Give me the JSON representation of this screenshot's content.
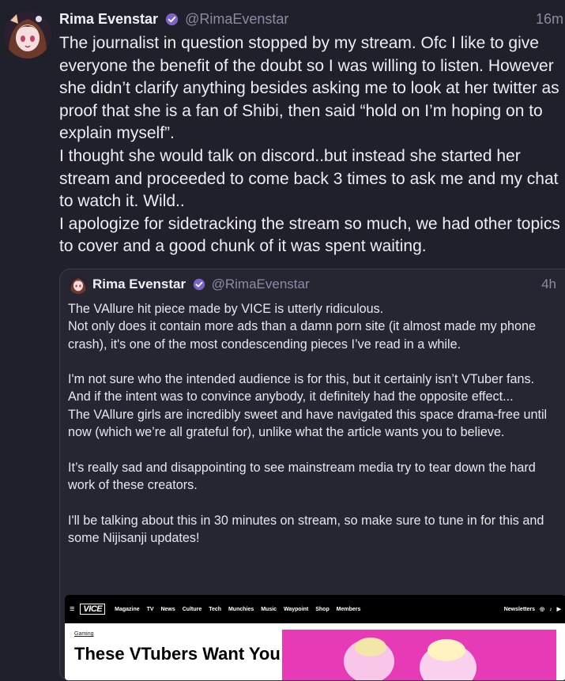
{
  "tweet": {
    "display_name": "Rima Evenstar",
    "handle": "@RimaEvenstar",
    "time": "16m",
    "paragraphs": [
      "The journalist in question stopped by my stream. Ofc I like to give everyone the benefit of the doubt so I was willing to listen. However she didn’t clarify anything besides asking me to look at her twitter as proof that she is a fan of Shibi, then said “hold on I’m hoping on to explain myself”.",
      "I thought she would talk on discord..but instead she started her stream and proceeded to come back 3 times to ask me and my chat to watch it. Wild..",
      "I apologize for sidetracking the stream so much, we had other topics to cover and a good chunk of it was spent waiting."
    ]
  },
  "quoted": {
    "display_name": "Rima Evenstar",
    "handle": "@RimaEvenstar",
    "time": "4h",
    "p1": "The VAllure hit piece made by VICE is utterly ridiculous.",
    "p2": "Not only does it contain more ads than a damn porn site (it almost made my phone crash), it's one of the most condescending pieces I’ve read in a while.",
    "p3": "I'm not sure who the intended audience is for this, but it certainly isn’t VTuber fans. And if the intent was to convince anybody, it definitely had the opposite effect...",
    "p4": "The VAllure girls are incredibly sweet and have navigated this space drama-free until now (which we’re all grateful for), unlike what the article wants you to believe.",
    "p5": "It’s really sad and disappointing to see mainstream media try to tear down the hard work of these creators.",
    "p6": "I'll be talking about this in 30 minutes on stream, so make sure to tune in for this and some Nijisanji updates!"
  },
  "embed": {
    "logo": "VICE",
    "nav": [
      "Magazine",
      "TV",
      "News",
      "Culture",
      "Tech",
      "Munchies",
      "Music",
      "Waypoint",
      "Shop",
      "Members"
    ],
    "newsletters": "Newsletters",
    "section": "Gaming",
    "headline": "These VTubers Want You to"
  },
  "colors": {
    "background": "#1f2029",
    "verified": "#7b61c8",
    "muted": "#8a8ca4",
    "embed_pink": "#e63ab7"
  }
}
